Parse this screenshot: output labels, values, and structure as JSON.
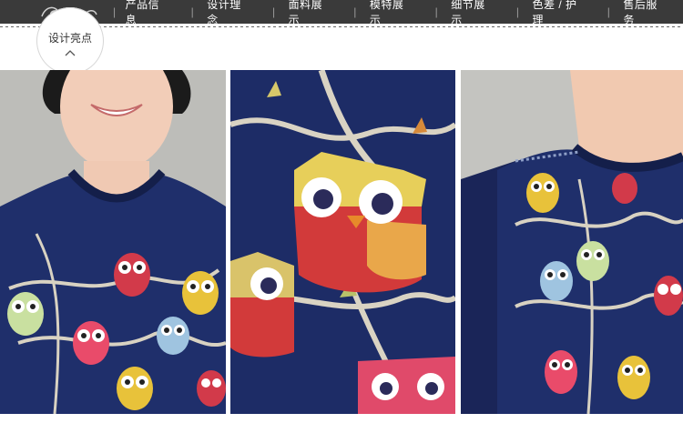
{
  "nav": {
    "items": [
      {
        "label": "产品信息"
      },
      {
        "label": "设计理念"
      },
      {
        "label": "面料展示"
      },
      {
        "label": "模特展示"
      },
      {
        "label": "细节展示"
      },
      {
        "label": "色差 / 护理"
      },
      {
        "label": "售后服务"
      }
    ]
  },
  "badge": {
    "title": "设计亮点"
  },
  "colors": {
    "nav_bg": "#3a3a3a",
    "fabric_navy": "#1f2f6b",
    "owl_red": "#d23a4a",
    "owl_yellow": "#e8c23a"
  },
  "panels": [
    {
      "name": "model-front-photo"
    },
    {
      "name": "fabric-closeup-photo"
    },
    {
      "name": "model-side-photo"
    }
  ]
}
